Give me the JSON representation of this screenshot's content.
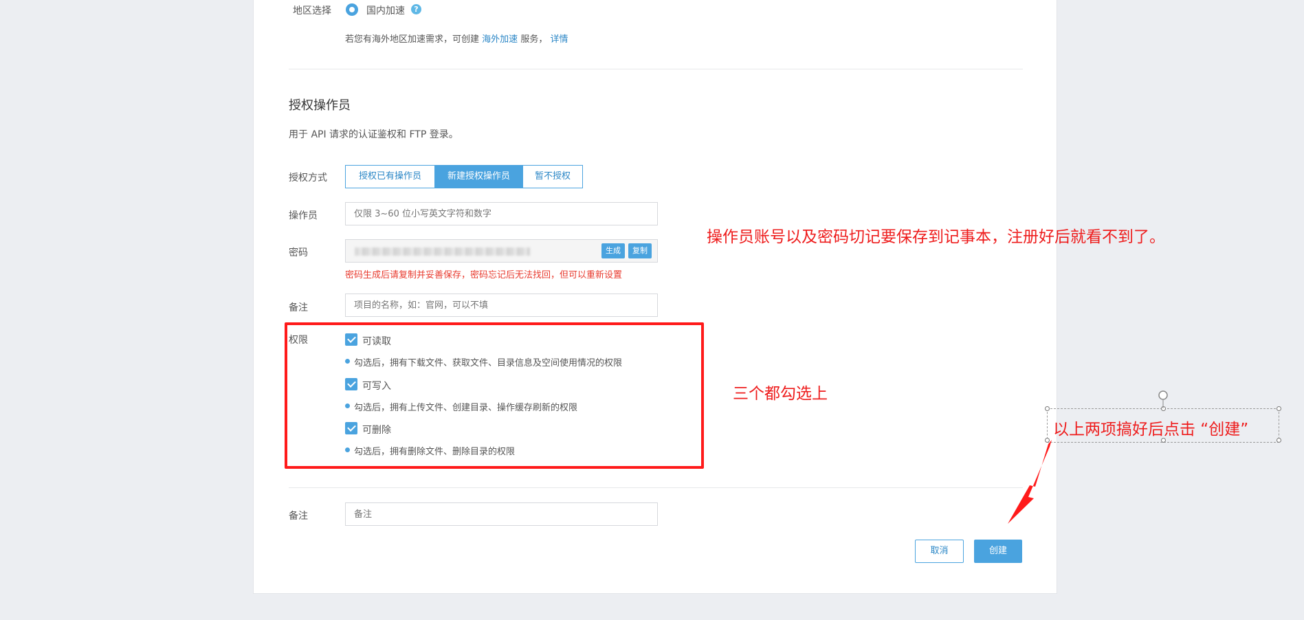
{
  "region": {
    "label": "地区选择",
    "option": "国内加速",
    "help": "?",
    "tip_prefix": "若您有海外地区加速需求，可创建",
    "tip_link": "海外加速",
    "tip_mid": "服务，",
    "tip_detail": "详情"
  },
  "operator_section": {
    "title": "授权操作员",
    "desc": "用于 API 请求的认证鉴权和 FTP 登录。"
  },
  "auth_mode": {
    "label": "授权方式",
    "options": [
      "授权已有操作员",
      "新建授权操作员",
      "暂不授权"
    ],
    "selected": "新建授权操作员"
  },
  "operator": {
    "label": "操作员",
    "placeholder": "仅限 3~60 位小写英文字符和数字"
  },
  "password": {
    "label": "密码",
    "generate": "生成",
    "copy": "复制",
    "warning": "密码生成后请复制并妥善保存，密码忘记后无法找回，但可以重新设置"
  },
  "remark1": {
    "label": "备注",
    "placeholder": "项目的名称，如：官网，可以不填"
  },
  "permissions": {
    "label": "权限",
    "items": [
      {
        "name": "可读取",
        "checked": true,
        "desc": "勾选后，拥有下载文件、获取文件、目录信息及空间使用情况的权限"
      },
      {
        "name": "可写入",
        "checked": true,
        "desc": "勾选后，拥有上传文件、创建目录、操作缓存刷新的权限"
      },
      {
        "name": "可删除",
        "checked": true,
        "desc": "勾选后，拥有删除文件、删除目录的权限"
      }
    ]
  },
  "remark2": {
    "label": "备注",
    "placeholder": "备注"
  },
  "actions": {
    "cancel": "取消",
    "create": "创建"
  },
  "annotations": {
    "save_note": "操作员账号以及密码切记要保存到记事本，注册好后就看不到了。",
    "check_all": "三个都勾选上",
    "click_create": "以上两项搞好后点击  “创建”"
  },
  "colors": {
    "accent": "#4aa3df",
    "annotation": "#ee1c1c",
    "background": "#eceef2"
  }
}
